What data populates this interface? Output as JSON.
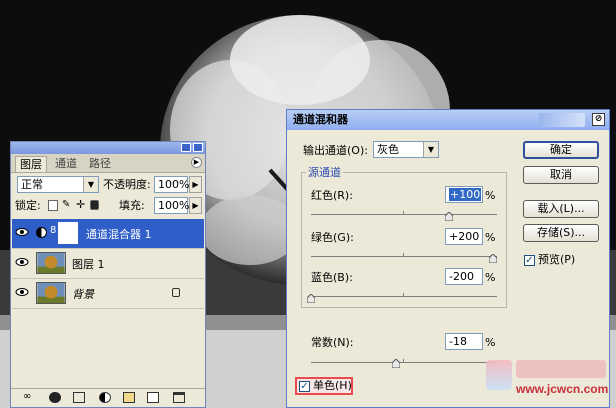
{
  "layers_panel": {
    "tabs": [
      "图层",
      "通道",
      "路径"
    ],
    "blend_mode": "正常",
    "opacity_label": "不透明度:",
    "opacity_value": "100%",
    "lock_label": "锁定:",
    "fill_label": "填充:",
    "fill_value": "100%",
    "layers": [
      {
        "name": "通道混合器 1",
        "selected": true
      },
      {
        "name": "图层 1",
        "selected": false
      },
      {
        "name": "背景",
        "selected": false,
        "italic": true
      }
    ]
  },
  "channel_mixer": {
    "title": "通道混和器",
    "output_channel_label": "输出通道(O):",
    "output_channel_value": "灰色",
    "source_group_label": "源通道",
    "red_label": "红色(R):",
    "red_value": "+100",
    "green_label": "绿色(G):",
    "green_value": "+200",
    "blue_label": "蓝色(B):",
    "blue_value": "-200",
    "constant_label": "常数(N):",
    "constant_value": "-18",
    "percent": "%",
    "monochrome_label": "单色(H)",
    "monochrome_checked": true,
    "preview_label": "预览(P)",
    "preview_checked": true,
    "ok_button": "确定",
    "cancel_button": "取消",
    "load_button": "载入(L)...",
    "save_button": "存储(S)..."
  },
  "watermark": {
    "site": "www.jcwcn.com"
  },
  "colors": {
    "selection_blue": "#2f5ec8",
    "dialog_title": "#8eaef0",
    "monochrome_highlight": "#e74b4b"
  }
}
